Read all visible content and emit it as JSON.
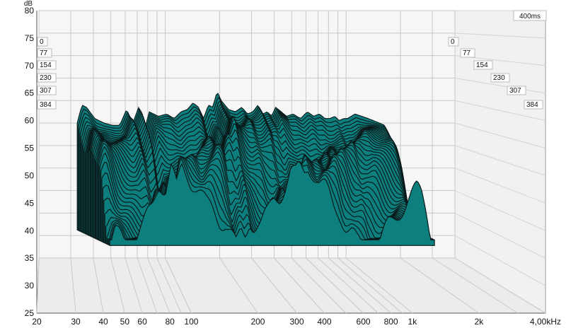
{
  "chart_data": {
    "type": "area",
    "ylabel": "dB",
    "y_ticks": [
      "80",
      "75",
      "70",
      "65",
      "60",
      "55",
      "50",
      "45",
      "40",
      "35",
      "30",
      "25"
    ],
    "ylim": [
      25,
      80
    ],
    "x_ticks": [
      "20",
      "30",
      "40",
      "50",
      "60",
      "80",
      "100",
      "200",
      "300",
      "400",
      "600",
      "800",
      "1k",
      "2k",
      "4,00kHz"
    ],
    "x_scale": "log",
    "xlim": [
      20,
      4000
    ],
    "time_axis_label": "400ms",
    "time_ticks": [
      "0",
      "77",
      "154",
      "230",
      "307",
      "384"
    ],
    "fill_color": "#0e7f7f",
    "line_color": "#0a1a1a",
    "grid": true,
    "series": [
      {
        "time_ms": 0,
        "note": "",
        "x": [
          32,
          34,
          36,
          40,
          45,
          50,
          55,
          60,
          65,
          70,
          75,
          80,
          90,
          100,
          110,
          120,
          130,
          140,
          150,
          160,
          170,
          180,
          190,
          200,
          220,
          240,
          260,
          280,
          300,
          320,
          340,
          360,
          380,
          400,
          430,
          460,
          500,
          550,
          600,
          650,
          700,
          750,
          800,
          850,
          900,
          950,
          1000,
          1100,
          1200,
          1300,
          1400,
          1500,
          1600,
          1700,
          1800,
          1900,
          2000
        ],
        "y": [
          55,
          59,
          58.5,
          56,
          55,
          54.5,
          54.5,
          58,
          55,
          58.5,
          53,
          57.5,
          56.5,
          57,
          56,
          57.5,
          58,
          59.5,
          58.5,
          56,
          59,
          58.5,
          62,
          60,
          58,
          57.5,
          58.5,
          57,
          57.5,
          59,
          57,
          57.5,
          56.5,
          58.5,
          57.5,
          56.5,
          57,
          56,
          57.5,
          56.5,
          57,
          56,
          56,
          56.5,
          55.5,
          56,
          56,
          57,
          56.5,
          56,
          55.5,
          55,
          54.5,
          52.5,
          49,
          44,
          38
        ]
      }
    ]
  }
}
